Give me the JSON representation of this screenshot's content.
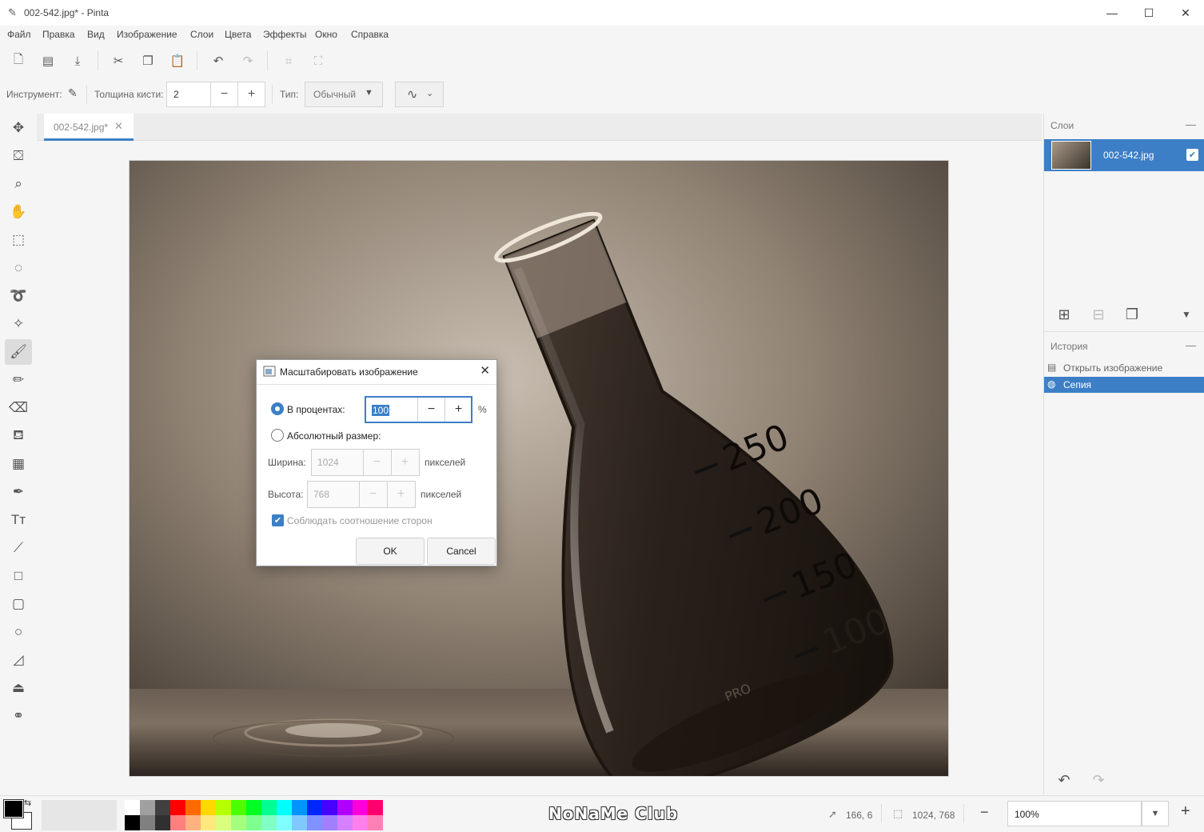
{
  "window": {
    "title": "002-542.jpg* - Pinta"
  },
  "menu": [
    "Файл",
    "Правка",
    "Вид",
    "Изображение",
    "Слои",
    "Цвета",
    "Эффекты",
    "Окно",
    "Справка"
  ],
  "toolbar": {
    "icons": [
      "new-image-icon",
      "open-icon",
      "save-icon",
      "cut-icon",
      "copy-icon",
      "paste-icon",
      "undo-icon",
      "redo-icon",
      "crop-icon",
      "deselect-icon"
    ]
  },
  "options": {
    "tool_label": "Инструмент:",
    "brush_width_label": "Толщина кисти:",
    "brush_width_value": "2",
    "type_label": "Тип:",
    "type_value": "Обычный"
  },
  "tools": [
    "move-selection",
    "move-selected",
    "zoom",
    "pan",
    "rectangle-select",
    "ellipse-select",
    "lasso-select",
    "magic-wand",
    "paintbrush",
    "pencil",
    "eraser",
    "paint-bucket",
    "gradient",
    "color-picker",
    "text",
    "line-curve",
    "rectangle",
    "rounded-rectangle",
    "ellipse",
    "freeform-shape",
    "clone-stamp",
    "recolor"
  ],
  "document": {
    "tab_label": "002-542.jpg*",
    "flask_marks": [
      "250",
      "200",
      "150",
      "100"
    ],
    "flask_brand": "PRO"
  },
  "dialog": {
    "title": "Масштабировать изображение",
    "by_percent_label": "В процентах:",
    "percent_value": "100",
    "percent_unit": "%",
    "absolute_label": "Абсолютный размер:",
    "width_label": "Ширина:",
    "width_value": "1024",
    "height_label": "Высота:",
    "height_value": "768",
    "pixels_unit": "пикселей",
    "keep_aspect_label": "Соблюдать соотношение сторон",
    "ok_label": "OK",
    "cancel_label": "Cancel"
  },
  "layers_panel": {
    "title": "Слои",
    "layers": [
      {
        "name": "002-542.jpg",
        "visible": true
      }
    ]
  },
  "history_panel": {
    "title": "История",
    "items": [
      {
        "label": "Открыть изображение",
        "selected": false
      },
      {
        "label": "Сепия",
        "selected": true
      }
    ]
  },
  "status": {
    "cursor_pos": "166, 6",
    "selection_size": "1024, 768",
    "zoom": "100%",
    "watermark": "NoNaMe Club"
  },
  "colors": {
    "accent": "#3c7fc6",
    "primary": "#000000",
    "secondary": "#ffffff",
    "palette_top": [
      "#ffffff",
      "#a0a0a0",
      "#404040",
      "#ff0000",
      "#ff6a00",
      "#ffd800",
      "#b6ff00",
      "#4cff00",
      "#00ff21",
      "#00ff90",
      "#00ffff",
      "#0094ff",
      "#0026ff",
      "#4800ff",
      "#b200ff",
      "#ff00dc",
      "#ff006e"
    ],
    "palette_bottom": [
      "#000000",
      "#808080",
      "#303030",
      "#ff7f7f",
      "#ffb27f",
      "#ffe97f",
      "#daff7f",
      "#a5ff7f",
      "#7fff8e",
      "#7fffc5",
      "#7fffff",
      "#7fc9ff",
      "#7f92ff",
      "#a17fff",
      "#d67fff",
      "#ff7fed",
      "#ff7fb6"
    ]
  }
}
